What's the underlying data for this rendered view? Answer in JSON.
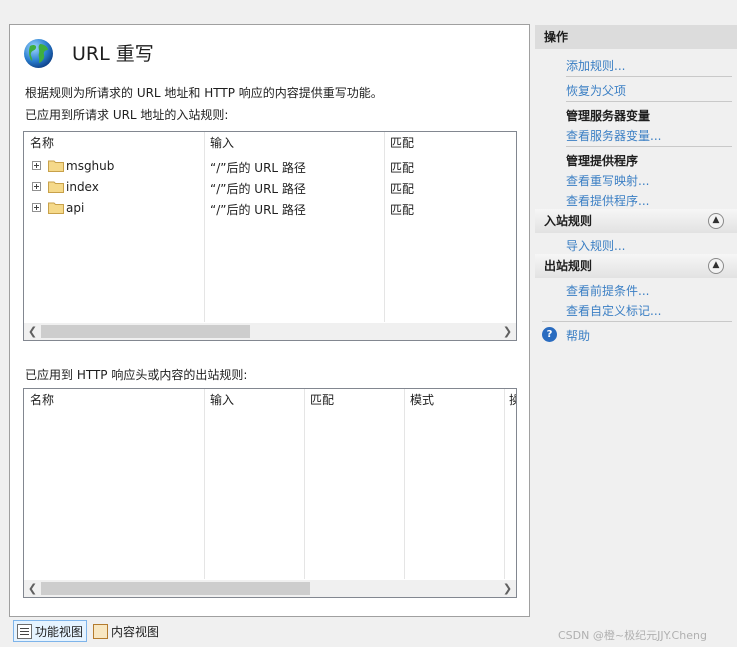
{
  "header": {
    "title": "URL 重写",
    "description": "根据规则为所请求的 URL 地址和 HTTP 响应的内容提供重写功能。"
  },
  "inbound": {
    "label": "已应用到所请求 URL 地址的入站规则:",
    "columns": [
      "名称",
      "输入",
      "匹配"
    ],
    "rows": [
      {
        "name": "msghub",
        "input": "“/”后的 URL 路径",
        "match": "匹配"
      },
      {
        "name": "index",
        "input": "“/”后的 URL 路径",
        "match": "匹配"
      },
      {
        "name": "api",
        "input": "“/”后的 URL 路径",
        "match": "匹配"
      }
    ]
  },
  "outbound": {
    "label": "已应用到 HTTP 响应头或内容的出站规则:",
    "columns": [
      "名称",
      "输入",
      "匹配",
      "模式",
      "操"
    ]
  },
  "view_tabs": {
    "features": "功能视图",
    "content": "内容视图"
  },
  "actions": {
    "header": "操作",
    "add_rule": "添加规则...",
    "revert": "恢复为父项",
    "server_vars_title": "管理服务器变量",
    "view_server_vars": "查看服务器变量...",
    "providers_title": "管理提供程序",
    "view_rewrite_maps": "查看重写映射...",
    "view_providers": "查看提供程序...",
    "inbound_header": "入站规则",
    "import_rules": "导入规则...",
    "outbound_header": "出站规则",
    "view_preconditions": "查看前提条件...",
    "view_custom_tags": "查看自定义标记...",
    "help": "帮助"
  },
  "watermark": "CSDN @橙~极纪元JJY.Cheng",
  "colors": {
    "link": "#3b7fc4",
    "header_bg": "#dcdcdc"
  }
}
